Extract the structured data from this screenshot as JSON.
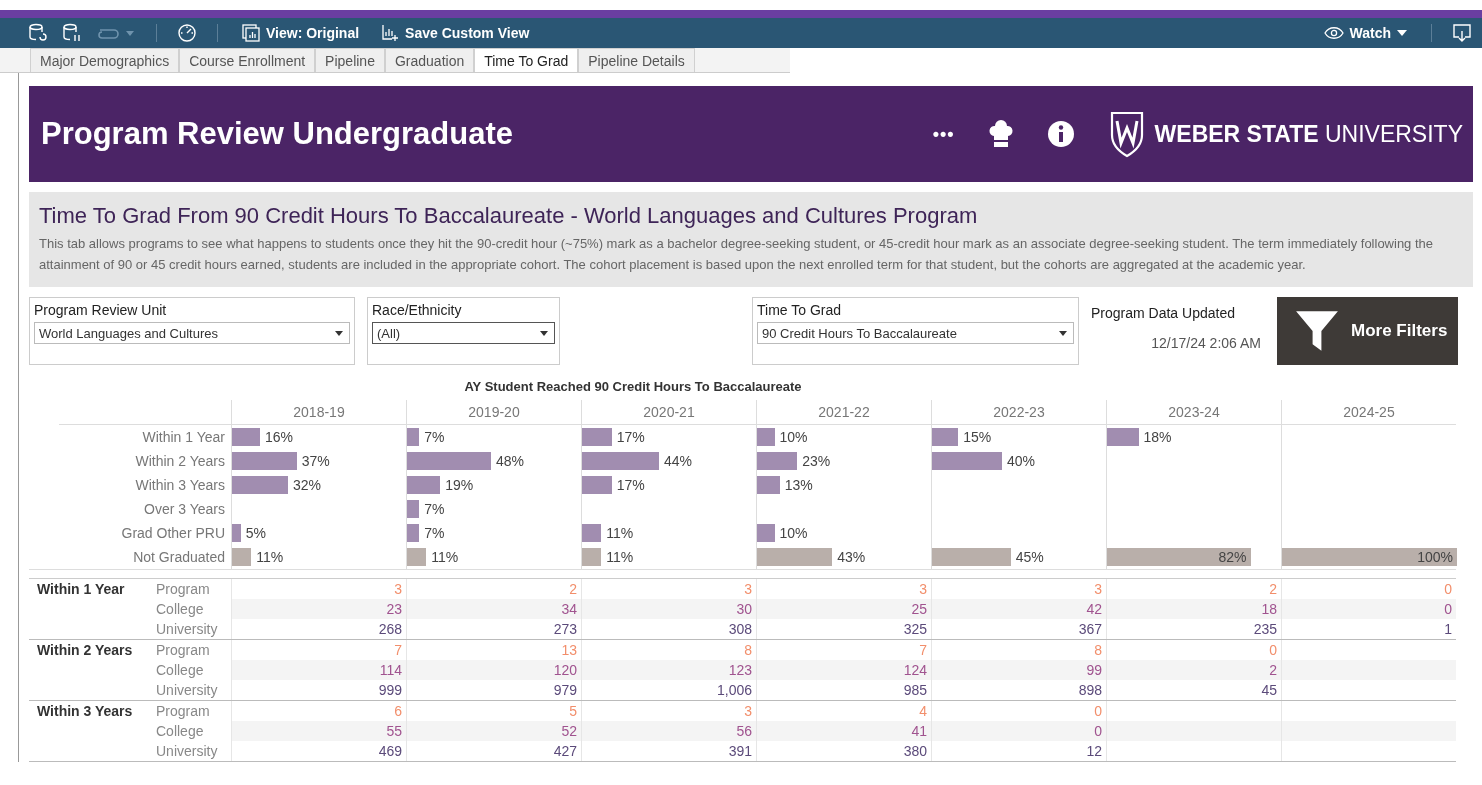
{
  "toolbar": {
    "view_button": "View: Original",
    "save_button": "Save Custom View",
    "watch_button": "Watch"
  },
  "tabs": [
    {
      "label": "Major Demographics",
      "selected": false
    },
    {
      "label": "Course Enrollment",
      "selected": false
    },
    {
      "label": "Pipeline",
      "selected": false
    },
    {
      "label": "Graduation",
      "selected": false
    },
    {
      "label": "Time To Grad",
      "selected": true
    },
    {
      "label": "Pipeline Details",
      "selected": false
    }
  ],
  "header": {
    "title": "Program Review Undergraduate",
    "more_icon": "•••",
    "logo_text": "**WEBER STATE** UNIVERSITY"
  },
  "intro": {
    "title": "Time To Grad From 90 Credit Hours To Baccalaureate - World Languages and Cultures Program",
    "text": "This tab allows programs to see what happens to students once they hit the 90-credit hour (~75%) mark as a bachelor degree-seeking student, or 45-credit hour mark as an associate degree-seeking student. The term immediately following the attainment of 90 or 45 credit hours earned, students are included in the appropriate cohort. The cohort placement is based upon the next enrolled term for that student, but the cohorts are aggregated at the academic year."
  },
  "filters": [
    {
      "label": "Program Review Unit",
      "value": "World Languages and Cultures"
    },
    {
      "label": "Race/Ethnicity",
      "value": "(All)"
    },
    {
      "label": "Time To Grad",
      "value": "90 Credit Hours To Baccalaureate"
    }
  ],
  "data_updated": {
    "label": "Program Data Updated",
    "value": "12/17/24 2:06 AM"
  },
  "more_filters_button": "More Filters",
  "bar_table": {
    "title": "AY Student Reached 90 Credit Hours To Baccalaureate",
    "columns": [
      "2018-19",
      "2019-20",
      "2020-21",
      "2021-22",
      "2022-23",
      "2023-24",
      "2024-25"
    ],
    "rows": [
      {
        "label": "Within 1 Year",
        "color": "#a18db0",
        "cells": [
          {
            "text": "16%",
            "level": 0.16
          },
          {
            "text": "7%",
            "level": 0.07
          },
          {
            "text": "17%",
            "level": 0.17
          },
          {
            "text": "10%",
            "level": 0.1
          },
          {
            "text": "15%",
            "level": 0.15
          },
          {
            "text": "18%",
            "level": 0.18
          },
          null
        ]
      },
      {
        "label": "Within 2 Years",
        "color": "#a18db0",
        "cells": [
          {
            "text": "37%",
            "level": 0.37
          },
          {
            "text": "48%",
            "level": 0.48
          },
          {
            "text": "44%",
            "level": 0.44
          },
          {
            "text": "23%",
            "level": 0.23
          },
          {
            "text": "40%",
            "level": 0.4
          },
          null,
          null
        ]
      },
      {
        "label": "Within 3 Years",
        "color": "#a18db0",
        "cells": [
          {
            "text": "32%",
            "level": 0.32
          },
          {
            "text": "19%",
            "level": 0.19
          },
          {
            "text": "17%",
            "level": 0.17
          },
          {
            "text": "13%",
            "level": 0.13
          },
          null,
          null,
          null
        ]
      },
      {
        "label": "Over 3 Years",
        "color": "#a18db0",
        "cells": [
          null,
          {
            "text": "7%",
            "level": 0.07
          },
          null,
          null,
          null,
          null,
          null
        ]
      },
      {
        "label": "Grad Other PRU",
        "color": "#a18db0",
        "cells": [
          {
            "text": "5%",
            "level": 0.05
          },
          {
            "text": "7%",
            "level": 0.07
          },
          {
            "text": "11%",
            "level": 0.11
          },
          {
            "text": "10%",
            "level": 0.1
          },
          null,
          null,
          null
        ]
      },
      {
        "label": "Not Graduated",
        "color": "#b9afaa",
        "cells": [
          {
            "text": "11%",
            "level": 0.11
          },
          {
            "text": "11%",
            "level": 0.11
          },
          {
            "text": "11%",
            "level": 0.11
          },
          {
            "text": "43%",
            "level": 0.43
          },
          {
            "text": "45%",
            "level": 0.45
          },
          {
            "text": "82%",
            "level": 0.82
          },
          {
            "text": "100%",
            "level": 1
          }
        ]
      }
    ]
  },
  "table": {
    "groups": [
      {
        "label": "Within 1 Year",
        "rows": [
          {
            "label": "Program",
            "color": "#f28e6b",
            "cells": [
              "3",
              "2",
              "3",
              "3",
              "3",
              "2",
              "0"
            ]
          },
          {
            "label": "College",
            "color": "#a0538f",
            "cells": [
              "23",
              "34",
              "30",
              "25",
              "42",
              "18",
              "0"
            ]
          },
          {
            "label": "University",
            "color": "#5b4a7a",
            "cells": [
              "268",
              "273",
              "308",
              "325",
              "367",
              "235",
              "1"
            ]
          }
        ]
      },
      {
        "label": "Within 2 Years",
        "rows": [
          {
            "label": "Program",
            "color": "#f28e6b",
            "cells": [
              "7",
              "13",
              "8",
              "7",
              "8",
              "0",
              null
            ]
          },
          {
            "label": "College",
            "color": "#a0538f",
            "cells": [
              "114",
              "120",
              "123",
              "124",
              "99",
              "2",
              null
            ]
          },
          {
            "label": "University",
            "color": "#5b4a7a",
            "cells": [
              "999",
              "979",
              "1,006",
              "985",
              "898",
              "45",
              null
            ]
          }
        ]
      },
      {
        "label": "Within 3 Years",
        "rows": [
          {
            "label": "Program",
            "color": "#f28e6b",
            "cells": [
              "6",
              "5",
              "3",
              "4",
              "0",
              null,
              null
            ]
          },
          {
            "label": "College",
            "color": "#a0538f",
            "cells": [
              "55",
              "52",
              "56",
              "41",
              "0",
              null,
              null
            ]
          },
          {
            "label": "University",
            "color": "#5b4a7a",
            "cells": [
              "469",
              "427",
              "391",
              "380",
              "12",
              null,
              null
            ]
          }
        ]
      }
    ]
  }
}
